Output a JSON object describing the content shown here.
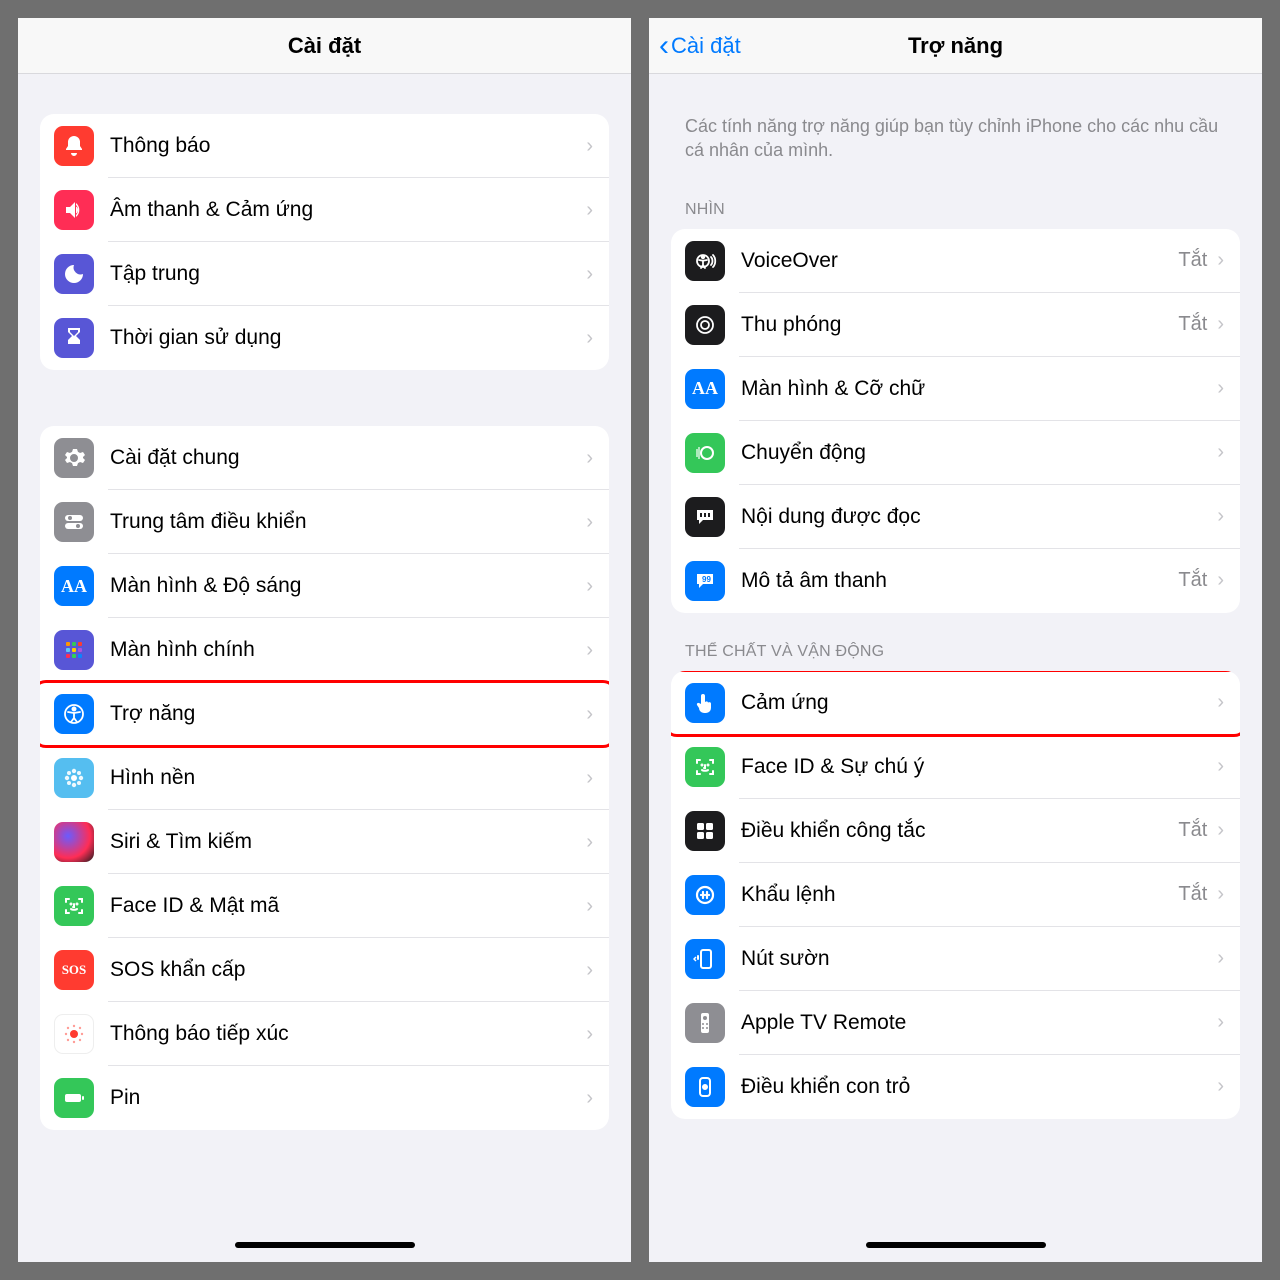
{
  "left": {
    "title": "Cài đặt",
    "group1": [
      {
        "label": "Thông báo"
      },
      {
        "label": "Âm thanh & Cảm ứng"
      },
      {
        "label": "Tập trung"
      },
      {
        "label": "Thời gian sử dụng"
      }
    ],
    "group2": [
      {
        "label": "Cài đặt chung"
      },
      {
        "label": "Trung tâm điều khiển"
      },
      {
        "label": "Màn hình & Độ sáng"
      },
      {
        "label": "Màn hình chính"
      },
      {
        "label": "Trợ năng",
        "highlight": true
      },
      {
        "label": "Hình nền"
      },
      {
        "label": "Siri & Tìm kiếm"
      },
      {
        "label": "Face ID & Mật mã"
      },
      {
        "label": "SOS khẩn cấp"
      },
      {
        "label": "Thông báo tiếp xúc"
      },
      {
        "label": "Pin"
      }
    ]
  },
  "right": {
    "back": "Cài đặt",
    "title": "Trợ năng",
    "description": "Các tính năng trợ năng giúp bạn tùy chỉnh iPhone cho các nhu cầu cá nhân của mình.",
    "section_vision": "NHÌN",
    "vision": [
      {
        "label": "VoiceOver",
        "status": "Tắt"
      },
      {
        "label": "Thu phóng",
        "status": "Tắt"
      },
      {
        "label": "Màn hình & Cỡ chữ"
      },
      {
        "label": "Chuyển động"
      },
      {
        "label": "Nội dung được đọc"
      },
      {
        "label": "Mô tả âm thanh",
        "status": "Tắt"
      }
    ],
    "section_physical": "THỂ CHẤT VÀ VẬN ĐỘNG",
    "physical": [
      {
        "label": "Cảm ứng",
        "highlight": true
      },
      {
        "label": "Face ID & Sự chú ý"
      },
      {
        "label": "Điều khiển công tắc",
        "status": "Tắt"
      },
      {
        "label": "Khẩu lệnh",
        "status": "Tắt"
      },
      {
        "label": "Nút sườn"
      },
      {
        "label": "Apple TV Remote"
      },
      {
        "label": "Điều khiển con trỏ"
      }
    ]
  },
  "off_label": "Tắt"
}
